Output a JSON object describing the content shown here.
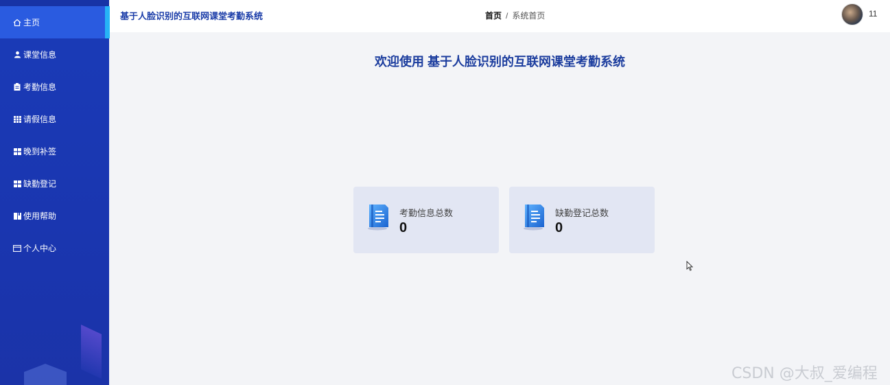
{
  "sidebar": {
    "items": [
      {
        "label": "主页",
        "icon": "home-icon"
      },
      {
        "label": "课堂信息",
        "icon": "user-icon"
      },
      {
        "label": "考勤信息",
        "icon": "clipboard-icon"
      },
      {
        "label": "请假信息",
        "icon": "grid-icon"
      },
      {
        "label": "晚到补签",
        "icon": "apps-icon"
      },
      {
        "label": "缺勤登记",
        "icon": "apps-icon"
      },
      {
        "label": "使用帮助",
        "icon": "book-icon"
      },
      {
        "label": "个人中心",
        "icon": "id-card-icon"
      }
    ]
  },
  "header": {
    "app_title": "基于人脸识别的互联网课堂考勤系统",
    "breadcrumb_home": "首页",
    "breadcrumb_sep": "/",
    "breadcrumb_current": "系统首页",
    "user_name": "11"
  },
  "main": {
    "welcome": "欢迎使用 基于人脸识别的互联网课堂考勤系统",
    "cards": [
      {
        "label": "考勤信息总数",
        "value": "0"
      },
      {
        "label": "缺勤登记总数",
        "value": "0"
      }
    ]
  },
  "watermark": "CSDN @大叔_爱编程",
  "colors": {
    "sidebar": "#1a3bb8",
    "active": "#2a5be0",
    "accent": "#26b3f6",
    "title": "#1c3d9e",
    "card": "#e2e6f3"
  }
}
